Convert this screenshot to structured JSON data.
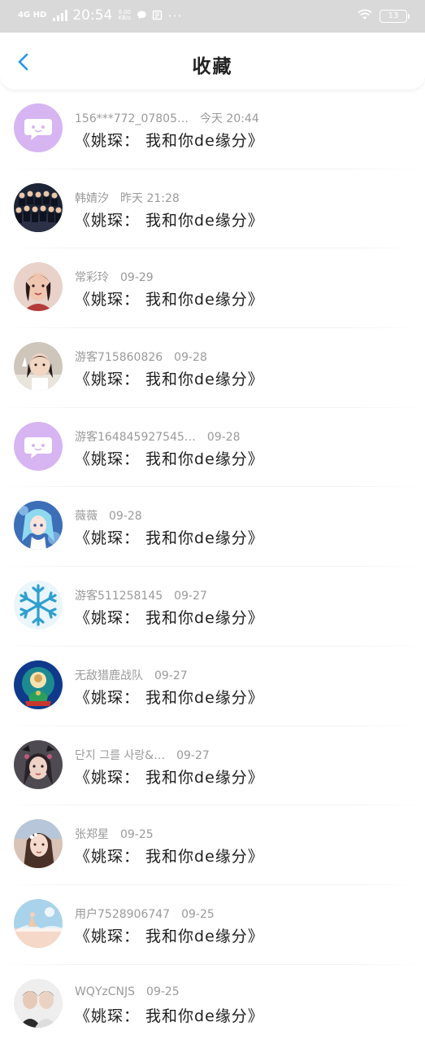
{
  "status_bar": {
    "network": "4G HD",
    "time": "20:54",
    "speed": "0.00 KB/s",
    "more": "···",
    "battery": "13"
  },
  "header": {
    "title": "收藏",
    "back_icon": "chevron-left-icon"
  },
  "colors": {
    "accent": "#2196f3",
    "status_bar_bg": "#d9d9d9",
    "meta_text": "#9a9a9a",
    "content_text": "#1e1e1e",
    "default_avatar_bg": "#d6b5f2"
  },
  "favorites": [
    {
      "name": "156***772_07805…",
      "time": "今天 20:44",
      "content": "《姚琛： 我和你de缘分》",
      "avatar": "default-chat-avatar"
    },
    {
      "name": "韩婧汐",
      "time": "昨天 21:28",
      "content": "《姚琛： 我和你de缘分》",
      "avatar": "group-photo-avatar"
    },
    {
      "name": "常彩玲",
      "time": "09-29",
      "content": "《姚琛： 我和你de缘分》",
      "avatar": "girl-portrait-avatar"
    },
    {
      "name": "游客715860826",
      "time": "09-28",
      "content": "《姚琛： 我和你de缘分》",
      "avatar": "child-photo-avatar"
    },
    {
      "name": "游客164845927545…",
      "time": "09-28",
      "content": "《姚琛： 我和你de缘分》",
      "avatar": "default-chat-avatar"
    },
    {
      "name": "薇薇",
      "time": "09-28",
      "content": "《姚琛： 我和你de缘分》",
      "avatar": "anime-girl-avatar"
    },
    {
      "name": "游客511258145",
      "time": "09-27",
      "content": "《姚琛： 我和你de缘分》",
      "avatar": "snowflake-avatar"
    },
    {
      "name": "无敌猎鹿战队",
      "time": "09-27",
      "content": "《姚琛： 我和你de缘分》",
      "avatar": "deity-painting-avatar"
    },
    {
      "name": "단지 그를 사랑&…",
      "time": "09-27",
      "content": "《姚琛： 我和你de缘分》",
      "avatar": "girl-flowers-avatar"
    },
    {
      "name": "张郑星",
      "time": "09-25",
      "content": "《姚琛： 我和你de缘分》",
      "avatar": "girl-sky-avatar"
    },
    {
      "name": "用户7528906747",
      "time": "09-25",
      "content": "《姚琛： 我和你de缘分》",
      "avatar": "pastel-sky-avatar"
    },
    {
      "name": "WQYzCNJS",
      "time": "09-25",
      "content": "《姚琛： 我和你de缘分》",
      "avatar": "couple-photo-avatar"
    }
  ]
}
